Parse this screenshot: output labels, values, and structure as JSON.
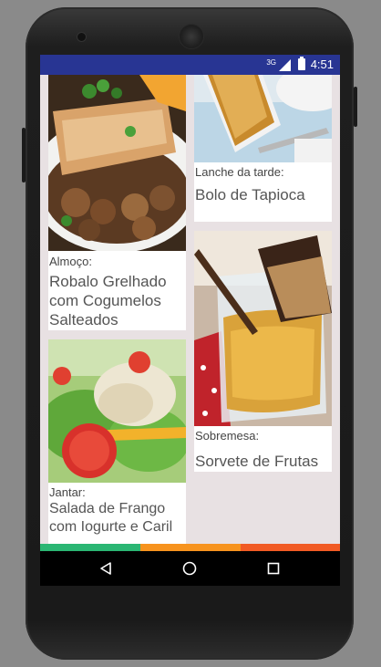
{
  "status_bar": {
    "network": "3G",
    "time": "4:51"
  },
  "cards": {
    "lunch": {
      "label": "Almoço:",
      "title": "Robalo Grelhado com Cogumelos Salteados"
    },
    "dinner": {
      "label": "Jantar:",
      "title": "Salada de Frango com Iogurte e Caril"
    },
    "snack": {
      "label": "Lanche da tarde:",
      "title": "Bolo de Tapioca"
    },
    "dessert": {
      "label": "Sobremesa:",
      "title": "Sorvete de Frutas"
    }
  },
  "colors": {
    "status_bar": "#283593",
    "strip_green": "#2bb673",
    "strip_orange": "#f7931e",
    "strip_red": "#f15a24",
    "background": "#e8e1e3"
  },
  "nav": {
    "back": "back-icon",
    "home": "home-icon",
    "recents": "recents-icon"
  }
}
